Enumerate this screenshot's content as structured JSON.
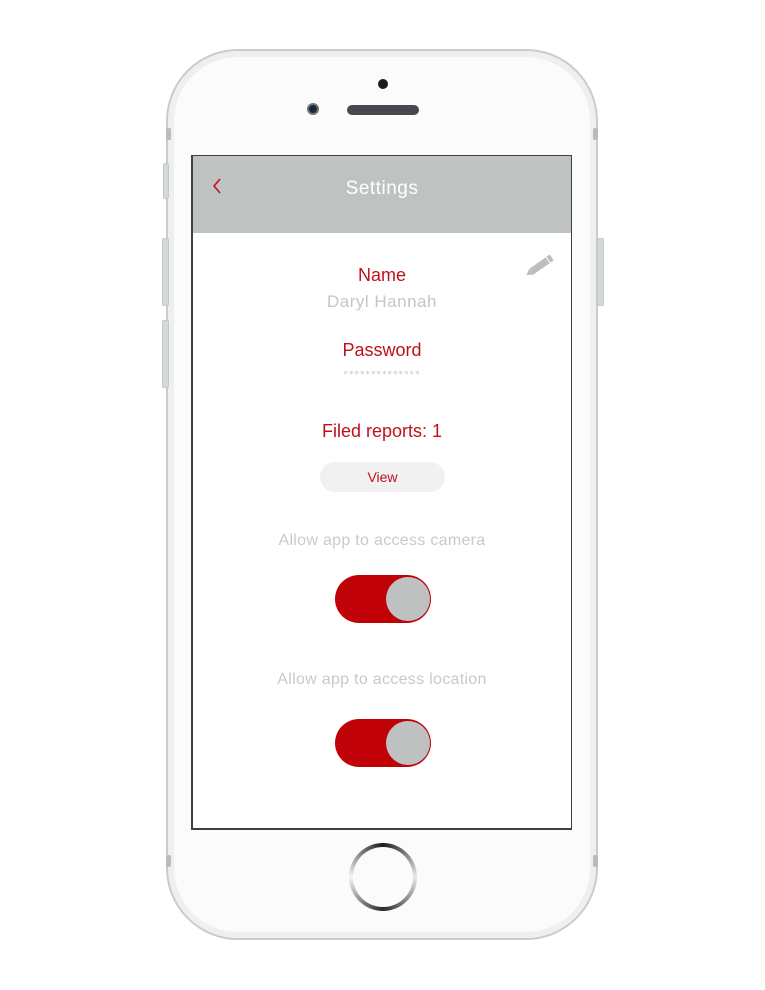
{
  "navbar": {
    "title": "Settings",
    "back_icon": "chevron-left-icon",
    "accent_color": "#c0101b",
    "background_color": "#bec3c1"
  },
  "profile": {
    "name_label": "Name",
    "name_value": "Daryl Hannah",
    "password_label": "Password",
    "password_value": "**************",
    "edit_icon": "pencil-icon"
  },
  "reports": {
    "filed_label": "Filed reports: 1",
    "view_label": "View"
  },
  "permissions": [
    {
      "label": "Allow app to access camera",
      "enabled": true
    },
    {
      "label": "Allow app to access location",
      "enabled": true
    }
  ],
  "colors": {
    "accent": "#c0101b",
    "toggle_on": "#c00208",
    "muted_text": "#c4c6c6"
  }
}
